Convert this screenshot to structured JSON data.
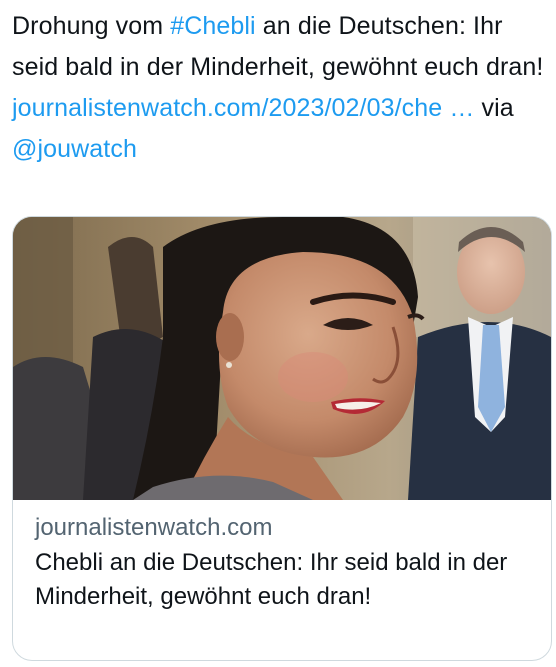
{
  "tweet": {
    "text_part1": "Drohung vom ",
    "hashtag": "#Chebli",
    "text_part2": " an die Deutschen: Ihr seid bald in der Minderheit, gewöhnt euch dran! ",
    "url": "journalistenwatch.com/2023/02/03/che",
    "ellipsis": "…",
    "via": " via ",
    "mention": "@jouwatch"
  },
  "card": {
    "image_alt": "Portrait photo of a smiling woman with dark hair pulled back, men in suits in the background",
    "domain": "journalistenwatch.com",
    "title": "Chebli an die Deutschen: Ihr seid bald in der Minderheit, gewöhnt euch dran!"
  },
  "colors": {
    "link": "#1d9bf0",
    "text": "#0f1419",
    "secondary": "#536471",
    "border": "#cfd9de"
  }
}
